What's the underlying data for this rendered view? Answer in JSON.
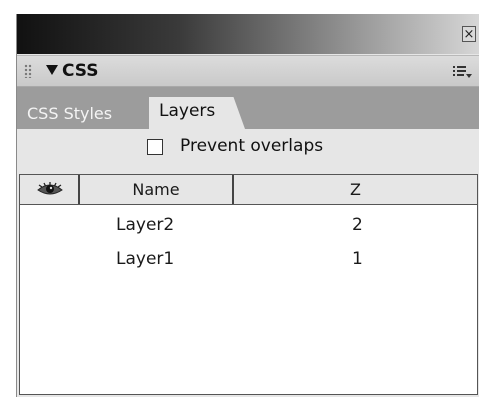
{
  "window": {
    "close_glyph": "×"
  },
  "panel": {
    "title": "CSS",
    "options_icon": "panel-options-icon"
  },
  "tabs": [
    {
      "label": "CSS Styles",
      "active": false
    },
    {
      "label": "Layers",
      "active": true
    }
  ],
  "prevent_overlaps": {
    "label": "Prevent overlaps",
    "checked": false
  },
  "layers_table": {
    "columns": {
      "visibility_icon": "eye-icon",
      "name": "Name",
      "z": "Z"
    },
    "rows": [
      {
        "name": "Layer2",
        "z": "2"
      },
      {
        "name": "Layer1",
        "z": "1"
      }
    ]
  }
}
